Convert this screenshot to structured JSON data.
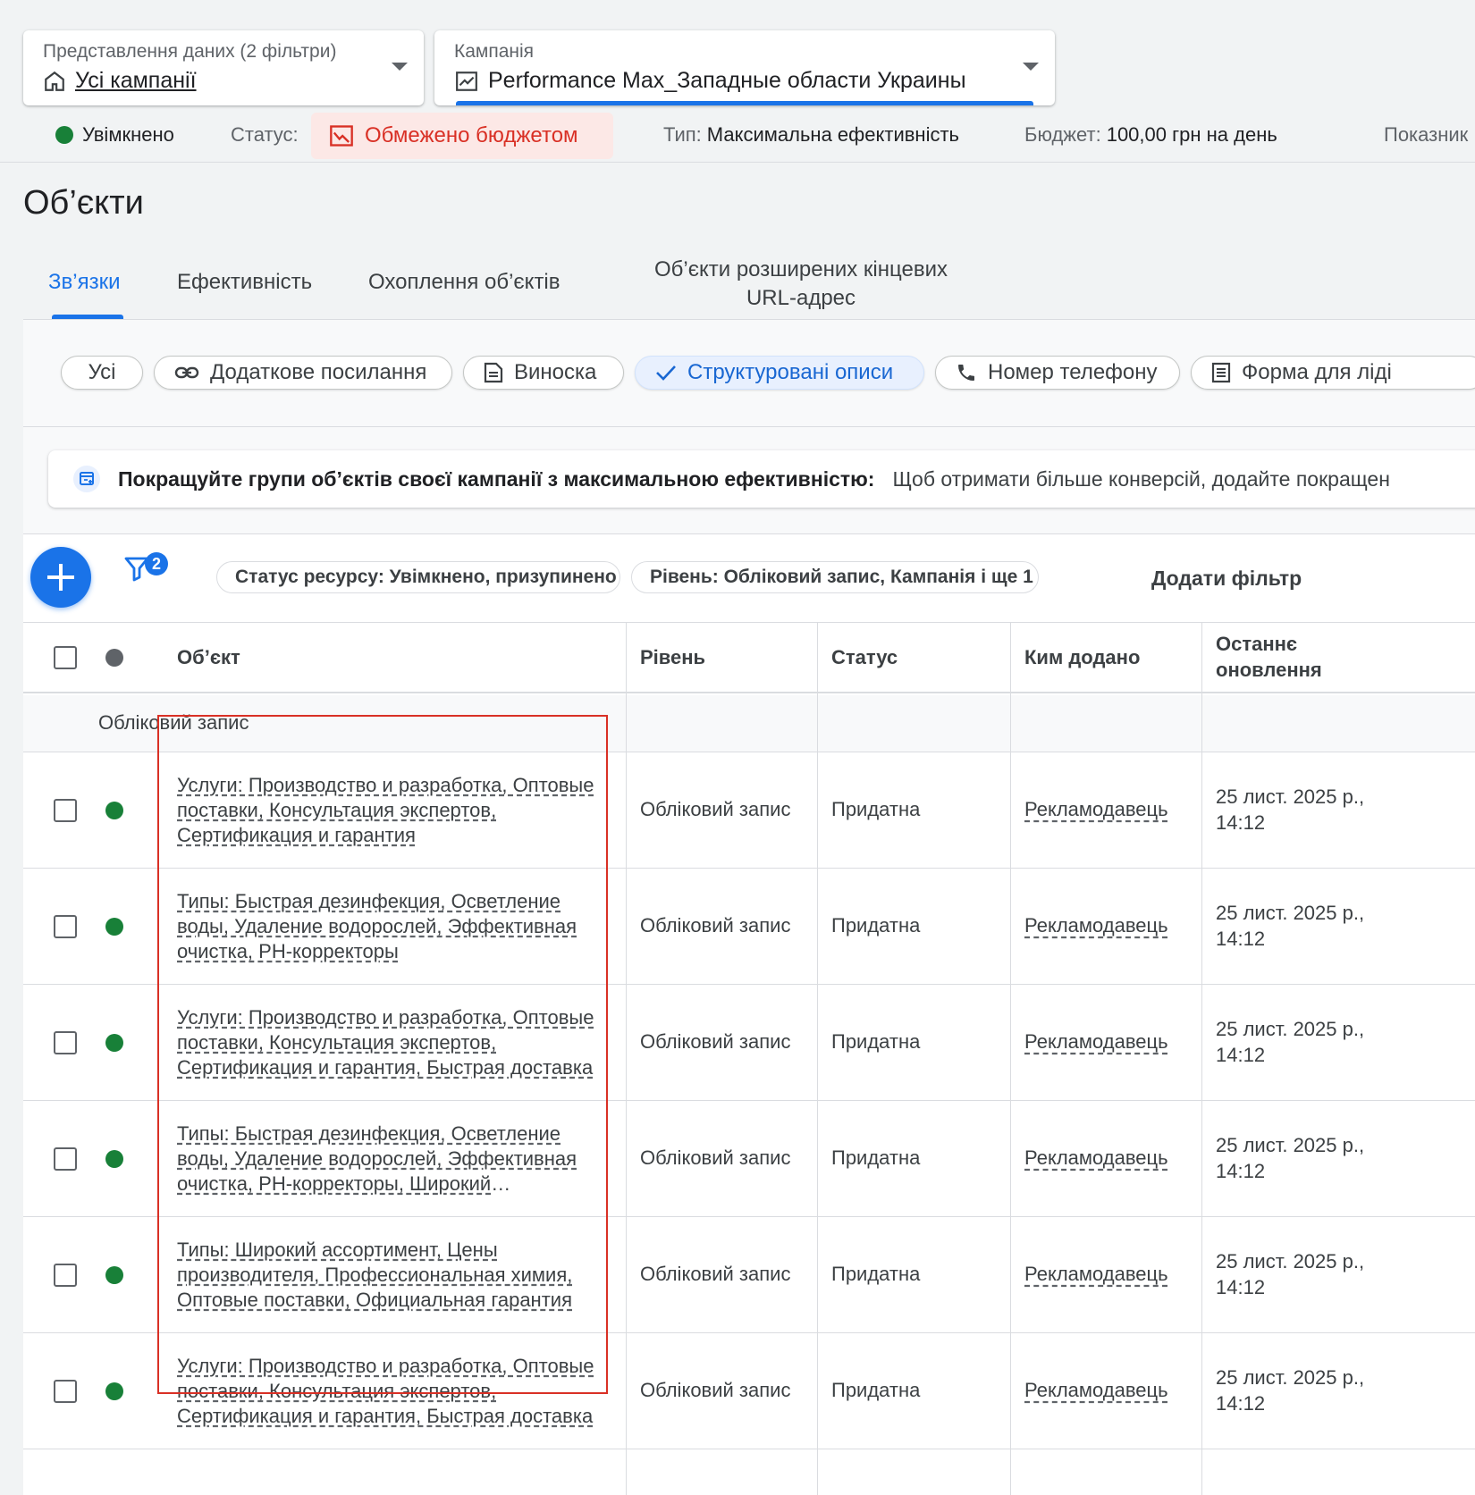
{
  "view_selector": {
    "label": "Представлення даних (2 фільтри)",
    "value": "Усі кампанії",
    "icon": "home-icon"
  },
  "campaign_selector": {
    "label": "Кампанія",
    "value": "Performance Max_Западные области Украины",
    "icon": "trending-chart-icon"
  },
  "status_bar": {
    "enabled": "Увімкнено",
    "status_label": "Статус:",
    "status_value": "Обмежено бюджетом",
    "type_label": "Тип:",
    "type_value": "Максимальна ефективність",
    "budget_label": "Бюджет:",
    "budget_value": "100,00 грн на день",
    "extra": "Показник",
    "colors": {
      "enabled_dot": "#188038",
      "limited_text": "#d93025",
      "limited_bg": "#fce8e6"
    }
  },
  "page_title": "Об’єкти",
  "tabs": [
    {
      "label": "Зв’язки",
      "active": true
    },
    {
      "label": "Ефективність"
    },
    {
      "label": "Охоплення об’єктів"
    },
    {
      "label": "Об’єкти розширених кінцевих URL-адрес"
    }
  ],
  "chips": [
    {
      "label": "Усі"
    },
    {
      "label": "Додаткове посилання",
      "icon": "link-icon"
    },
    {
      "label": "Виноска",
      "icon": "note-icon"
    },
    {
      "label": "Структуровані описи",
      "icon": "check-icon",
      "selected": true
    },
    {
      "label": "Номер телефону",
      "icon": "phone-icon"
    },
    {
      "label": "Форма для ліді",
      "icon": "form-icon"
    }
  ],
  "banner": {
    "title": "Покращуйте групи об’єктів своєї кампанії з максимальною ефективністю:",
    "text": "Щоб отримати більше конверсій, додайте покращен"
  },
  "toolbar": {
    "filter_count": "2",
    "filters": [
      "Статус ресурсу: Увімкнено, призупинено",
      "Рівень: Обліковий запис, Кампанія і ще 1"
    ],
    "add_filter": "Додати фільтр"
  },
  "table": {
    "headers": {
      "object": "Об’єкт",
      "level": "Рівень",
      "status": "Статус",
      "added_by": "Ким додано",
      "updated": "Останнє оновлення"
    },
    "group": "Обліковий запис",
    "rows": [
      {
        "object": "Услуги: Производство и разработка, Оптовые поставки, Консультация экспертов, Сертификация и гарантия",
        "level": "Обліковий запис",
        "status": "Придатна",
        "added_by": "Рекламодавець",
        "updated_date": "25 лист. 2025 р.,",
        "updated_time": "14:12"
      },
      {
        "object": "Типы: Быстрая дезинфекция, Осветление воды, Удаление водорослей, Эффективная очистка, PH-корректоры",
        "level": "Обліковий запис",
        "status": "Придатна",
        "added_by": "Рекламодавець",
        "updated_date": "25 лист. 2025 р.,",
        "updated_time": "14:12"
      },
      {
        "object": "Услуги: Производство и разработка, Оптовые поставки, Консультация экспертов, Сертификация и гарантия, Быстрая доставка",
        "level": "Обліковий запис",
        "status": "Придатна",
        "added_by": "Рекламодавець",
        "updated_date": "25 лист. 2025 р.,",
        "updated_time": "14:12"
      },
      {
        "object": "Типы: Быстрая дезинфекция, Осветление воды, Удаление водорослей, Эффективная очистка, PH-корректоры, Широкий ассортимент",
        "level": "Обліковий запис",
        "status": "Придатна",
        "added_by": "Рекламодавець",
        "updated_date": "25 лист. 2025 р.,",
        "updated_time": "14:12"
      },
      {
        "object": "Типы: Широкий ассортимент, Цены производителя, Профессиональная химия, Оптовые поставки, Официальная гарантия",
        "level": "Обліковий запис",
        "status": "Придатна",
        "added_by": "Рекламодавець",
        "updated_date": "25 лист. 2025 р.,",
        "updated_time": "14:12"
      },
      {
        "object": "Услуги: Производство и разработка, Оптовые поставки, Консультация экспертов, Сертификация и гарантия, Быстрая доставка",
        "level": "Обліковий запис",
        "status": "Придатна",
        "added_by": "Рекламодавець",
        "updated_date": "25 лист. 2025 р.,",
        "updated_time": "14:12"
      }
    ]
  }
}
